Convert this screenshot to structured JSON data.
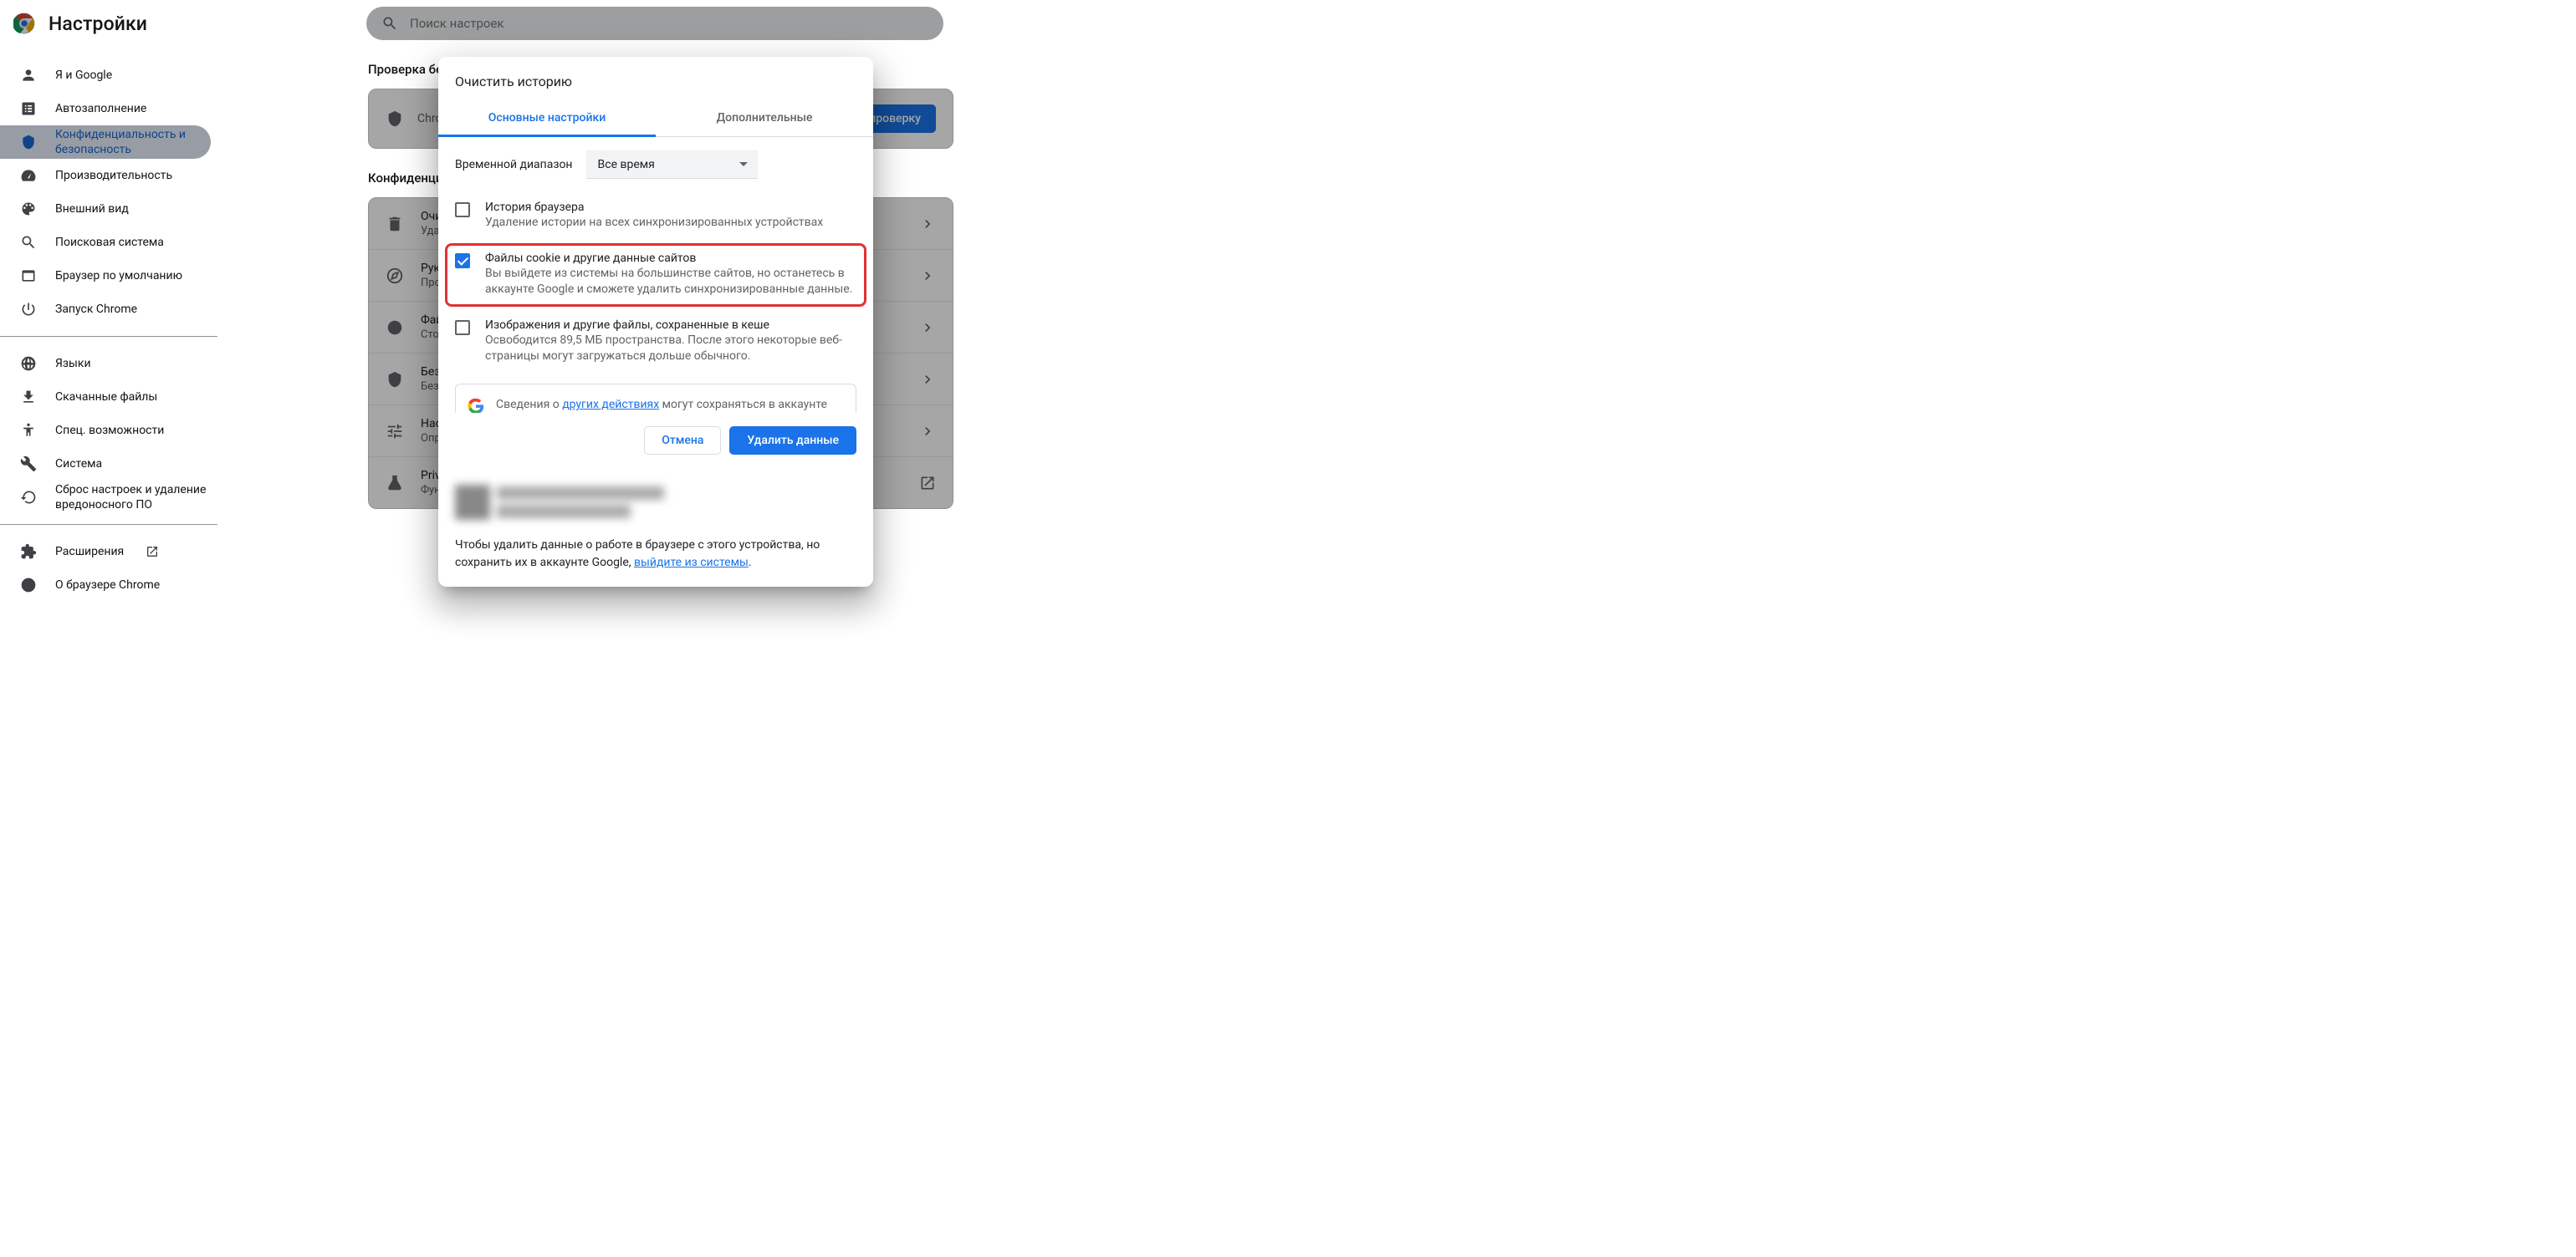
{
  "header": {
    "title": "Настройки"
  },
  "search": {
    "placeholder": "Поиск настроек"
  },
  "sidebar": {
    "items": [
      {
        "label": "Я и Google",
        "icon": "person-icon"
      },
      {
        "label": "Автозаполнение",
        "icon": "form-icon"
      },
      {
        "label": "Конфиденциальность и безопасность",
        "icon": "shield-icon",
        "active": true
      },
      {
        "label": "Производительность",
        "icon": "speed-icon"
      },
      {
        "label": "Внешний вид",
        "icon": "palette-icon"
      },
      {
        "label": "Поисковая система",
        "icon": "search-icon"
      },
      {
        "label": "Браузер по умолчанию",
        "icon": "window-icon"
      },
      {
        "label": "Запуск Chrome",
        "icon": "power-icon"
      }
    ],
    "lang": "Языки",
    "downloads": "Скачанные файлы",
    "accessibility": "Спец. возможности",
    "system": "Система",
    "reset": "Сброс настроек и удаление вредоносного ПО",
    "extensions": "Расширения",
    "about": "О браузере Chrome"
  },
  "main": {
    "check_section": "Проверка бе",
    "check_desc": "Chro расш",
    "check_btn": "Выполнить проверку",
    "priv_section": "Конфиденци",
    "rows": [
      {
        "title": "Очи",
        "desc": "Уда"
      },
      {
        "title": "Рук",
        "desc": "Про"
      },
      {
        "title": "Фай",
        "desc": "Стор"
      },
      {
        "title": "Безо",
        "desc": "Безо"
      },
      {
        "title": "Наст",
        "desc": "Опре ли у окон"
      },
      {
        "title": "Priva",
        "desc": "Фун"
      }
    ]
  },
  "dialog": {
    "title": "Очистить историю",
    "tab_basic": "Основные настройки",
    "tab_advanced": "Дополнительные",
    "time_label": "Временной диапазон",
    "time_value": "Все время",
    "opts": [
      {
        "title": "История браузера",
        "desc": "Удаление истории на всех синхронизированных устройствах",
        "checked": false
      },
      {
        "title": "Файлы cookie и другие данные сайтов",
        "desc": "Вы выйдете из системы на большинстве сайтов, но останетесь в аккаунте Google и сможете удалить синхронизированные данные.",
        "checked": true,
        "highlighted": true
      },
      {
        "title": "Изображения и другие файлы, сохраненные в кеше",
        "desc": "Освободится 89,5 МБ пространства. После этого некоторые веб-страницы могут загружаться дольше обычного.",
        "checked": false
      }
    ],
    "info_pre": "Сведения о ",
    "info_link": "других действиях",
    "info_post": " могут сохраняться в аккаунте Google, если вы в него вошли. Эти данные можно удалить в",
    "signout_pre": "Чтобы удалить данные о работе в браузере с этого устройства, но сохранить их в аккаунте Google, ",
    "signout_link": "выйдите из системы",
    "cancel": "Отмена",
    "confirm": "Удалить данные"
  }
}
